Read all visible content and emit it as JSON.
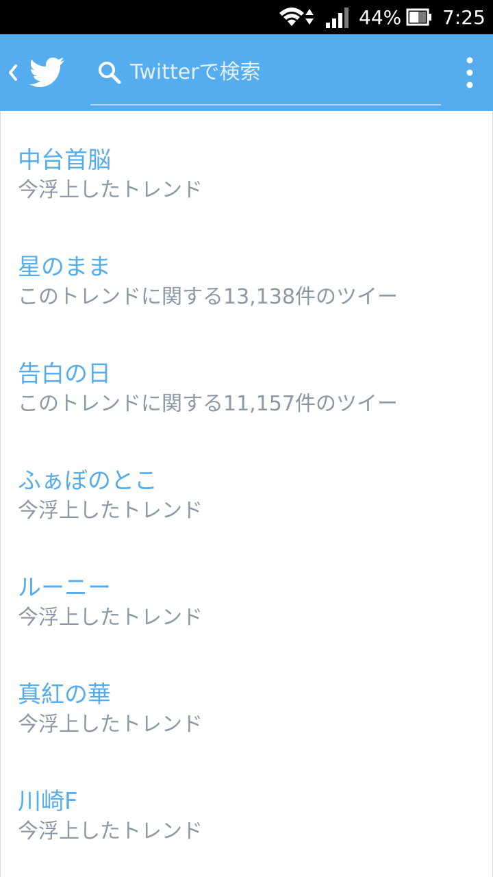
{
  "status_bar": {
    "battery_percent": "44%",
    "time": "7:25",
    "icons": [
      "wifi-icon",
      "signal-icon",
      "battery-icon"
    ]
  },
  "action_bar": {
    "icons": [
      "back-icon",
      "twitter-bird-icon",
      "search-icon",
      "overflow-menu-icon"
    ],
    "search_placeholder": "Twitterで検索"
  },
  "colors": {
    "accent": "#55acee",
    "secondary_text": "#8a99a5",
    "status_bar": "#000000"
  },
  "trends": [
    {
      "name": "中台首脳",
      "description": "今浮上したトレンド"
    },
    {
      "name": "星のまま",
      "description": "このトレンドに関する13,138件のツイー"
    },
    {
      "name": "告白の日",
      "description": "このトレンドに関する11,157件のツイー"
    },
    {
      "name": "ふぁぼのとこ",
      "description": "今浮上したトレンド"
    },
    {
      "name": "ルーニー",
      "description": "今浮上したトレンド"
    },
    {
      "name": "真紅の華",
      "description": "今浮上したトレンド"
    },
    {
      "name": "川崎F",
      "description": "今浮上したトレンド"
    }
  ]
}
